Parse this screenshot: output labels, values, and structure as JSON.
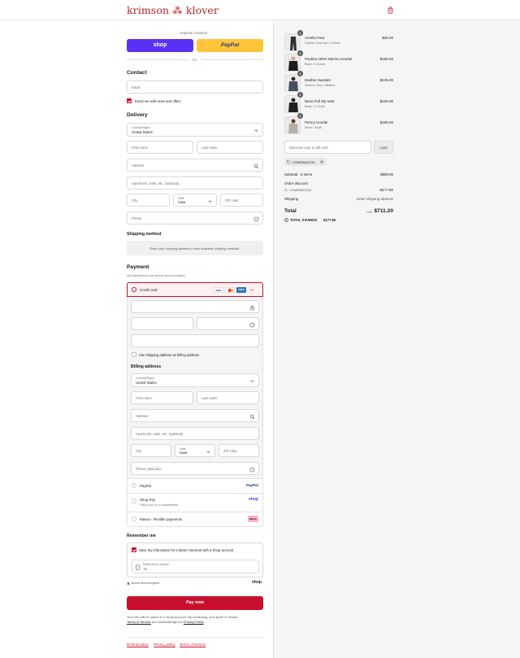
{
  "brand": {
    "logo": "krimson ⁂ klover",
    "accent": "#c8102e",
    "shop_purple": "#5a31f4",
    "paypal_yellow": "#ffc439"
  },
  "express": {
    "title": "Express checkout",
    "shop_label": "shop",
    "paypal_label": "PayPal",
    "or_label": "OR"
  },
  "contact": {
    "title": "Contact",
    "email_placeholder": "Email",
    "newsletter_label": "Email me with news and offers"
  },
  "delivery": {
    "title": "Delivery",
    "country_label": "Country/Region",
    "country_value": "United States",
    "first_name": "First name",
    "last_name": "Last name",
    "address": "Address",
    "apartment": "Apartment, suite, etc. (optional)",
    "city": "City",
    "state_label": "State",
    "state_value": "Iowa",
    "zip": "ZIP code",
    "phone": "Phone"
  },
  "shipping": {
    "title": "Shipping method",
    "notice": "Enter your shipping address to view available shipping methods."
  },
  "payment": {
    "title": "Payment",
    "subtitle": "All transactions are secure and encrypted.",
    "credit_card_label": "Credit card",
    "more_cards": "+3",
    "card_logos": [
      "VISA",
      "mastercard",
      "AMEX"
    ],
    "billing_same_label": "Use shipping address as billing address",
    "billing_title": "Billing address",
    "billing": {
      "country_label": "Country/Region",
      "country_value": "United States",
      "first_name": "First name",
      "last_name": "Last name",
      "address": "Address",
      "apartment": "Apartment, suite, etc. (optional)",
      "city": "City",
      "state_label": "State",
      "state_value": "Iowa",
      "zip": "ZIP code",
      "phone": "Phone (optional)"
    },
    "paypal_label": "PayPal",
    "paypal_logo": "PayPal",
    "shoppay_label": "Shop Pay",
    "shoppay_sub": "Pay in full or in installments",
    "shoppay_logo": "shop",
    "klarna_label": "Klarna - Flexible payments",
    "klarna_logo": "Klarna."
  },
  "remember": {
    "title": "Remember me",
    "save_label": "Save my information for a faster checkout with a Shop account",
    "mobile_label": "Mobile phone number",
    "mobile_value": "+1",
    "secure_label": "Secure and encrypted",
    "shop_logo": "shop"
  },
  "pay_button": "Pay now",
  "legal": {
    "line1": "Your info will be saved to a Shop account. By continuing, you agree to Shop's",
    "terms": "Terms of Service",
    "middle": " and acknowledge the ",
    "privacy": "Privacy Policy",
    "end": "."
  },
  "footer": {
    "refund": "Refund policy",
    "privacy": "Privacy policy",
    "terms": "Terms of service"
  },
  "cart": {
    "items": [
      {
        "name": "Amelia Pant",
        "variant": "Heather Charcoal / X-Small",
        "price": "$25.00",
        "qty": "1"
      },
      {
        "name": "Paulina 100% Merino Hoodie",
        "variant": "Black / X-Small",
        "price": "$186.00",
        "qty": "1"
      },
      {
        "name": "Dasher Sweater",
        "variant": "Medium Grey / Medium",
        "price": "$246.00",
        "qty": "1"
      },
      {
        "name": "Neva Full Zip Vest",
        "variant": "Black / X-Small",
        "price": "$236.00",
        "qty": "1"
      },
      {
        "name": "Penny Hoodie",
        "variant": "Silver / Small",
        "price": "$196.00",
        "qty": "1"
      }
    ],
    "discount_placeholder": "Discount code or gift card",
    "apply_label": "Apply",
    "applied_code": "COMEBACK20",
    "subtotal_label": "Subtotal · 5 items",
    "subtotal_value": "$889.00",
    "order_discount_label": "Order discount",
    "discount_code": "COMEBACK20",
    "discount_value": "−$177.80",
    "shipping_label": "Shipping",
    "shipping_value": "Enter shipping address",
    "total_label": "Total",
    "currency": "USD",
    "total_value": "$711.20",
    "savings_label": "TOTAL SAVINGS",
    "savings_value": "$177.80"
  }
}
